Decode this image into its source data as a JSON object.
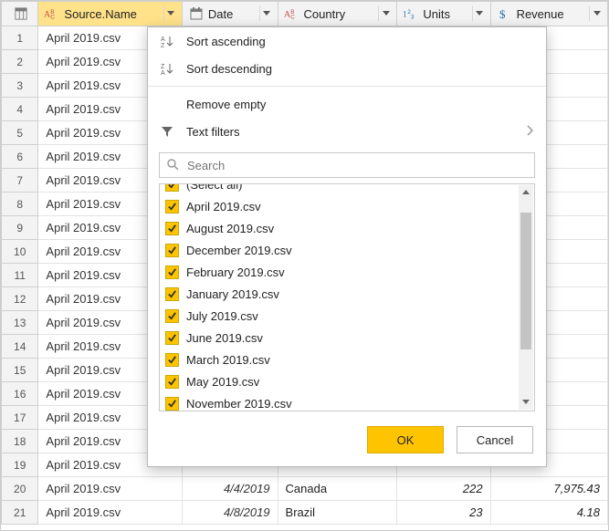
{
  "columns": {
    "source": "Source.Name",
    "date": "Date",
    "country": "Country",
    "units": "Units",
    "revenue": "Revenue"
  },
  "rows": [
    {
      "n": "1",
      "src": "April 2019.csv",
      "date": "",
      "country": "",
      "units": "",
      "rev": ""
    },
    {
      "n": "2",
      "src": "April 2019.csv",
      "date": "",
      "country": "",
      "units": "",
      "rev": ""
    },
    {
      "n": "3",
      "src": "April 2019.csv",
      "date": "",
      "country": "",
      "units": "",
      "rev": ""
    },
    {
      "n": "4",
      "src": "April 2019.csv",
      "date": "",
      "country": "",
      "units": "",
      "rev": ""
    },
    {
      "n": "5",
      "src": "April 2019.csv",
      "date": "",
      "country": "",
      "units": "",
      "rev": ""
    },
    {
      "n": "6",
      "src": "April 2019.csv",
      "date": "",
      "country": "",
      "units": "",
      "rev": ""
    },
    {
      "n": "7",
      "src": "April 2019.csv",
      "date": "",
      "country": "",
      "units": "",
      "rev": ""
    },
    {
      "n": "8",
      "src": "April 2019.csv",
      "date": "",
      "country": "",
      "units": "",
      "rev": ""
    },
    {
      "n": "9",
      "src": "April 2019.csv",
      "date": "",
      "country": "",
      "units": "",
      "rev": ""
    },
    {
      "n": "10",
      "src": "April 2019.csv",
      "date": "",
      "country": "",
      "units": "",
      "rev": ""
    },
    {
      "n": "11",
      "src": "April 2019.csv",
      "date": "",
      "country": "",
      "units": "",
      "rev": ""
    },
    {
      "n": "12",
      "src": "April 2019.csv",
      "date": "",
      "country": "",
      "units": "",
      "rev": ""
    },
    {
      "n": "13",
      "src": "April 2019.csv",
      "date": "",
      "country": "",
      "units": "",
      "rev": ""
    },
    {
      "n": "14",
      "src": "April 2019.csv",
      "date": "",
      "country": "",
      "units": "",
      "rev": ""
    },
    {
      "n": "15",
      "src": "April 2019.csv",
      "date": "",
      "country": "",
      "units": "",
      "rev": ""
    },
    {
      "n": "16",
      "src": "April 2019.csv",
      "date": "",
      "country": "",
      "units": "",
      "rev": ""
    },
    {
      "n": "17",
      "src": "April 2019.csv",
      "date": "",
      "country": "",
      "units": "",
      "rev": ""
    },
    {
      "n": "18",
      "src": "April 2019.csv",
      "date": "",
      "country": "",
      "units": "",
      "rev": ""
    },
    {
      "n": "19",
      "src": "April 2019.csv",
      "date": "",
      "country": "",
      "units": "",
      "rev": ""
    },
    {
      "n": "20",
      "src": "April 2019.csv",
      "date": "4/4/2019",
      "country": "Canada",
      "units": "222",
      "rev": "7,975.43"
    },
    {
      "n": "21",
      "src": "April 2019.csv",
      "date": "4/8/2019",
      "country": "Brazil",
      "units": "23",
      "rev": "4.18"
    }
  ],
  "popup": {
    "sort_asc": "Sort ascending",
    "sort_desc": "Sort descending",
    "remove_empty": "Remove empty",
    "text_filters": "Text filters",
    "search_placeholder": "Search",
    "select_all": "(Select all)",
    "options": [
      "April 2019.csv",
      "August 2019.csv",
      "December 2019.csv",
      "February 2019.csv",
      "January 2019.csv",
      "July 2019.csv",
      "June 2019.csv",
      "March 2019.csv",
      "May 2019.csv",
      "November 2019.csv"
    ],
    "ok": "OK",
    "cancel": "Cancel"
  }
}
